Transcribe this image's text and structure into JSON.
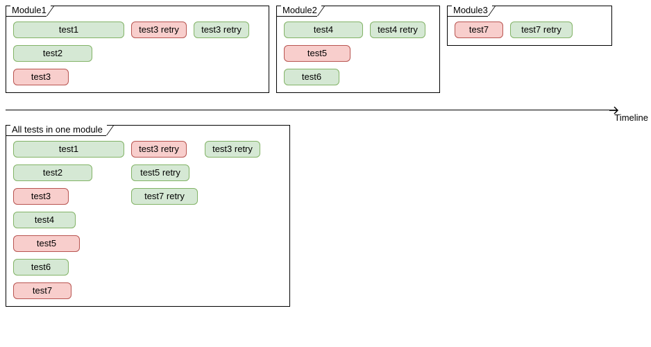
{
  "modules": {
    "m1": {
      "title": "Module1",
      "col1": [
        "test1",
        "test2",
        "test3"
      ],
      "col2": [
        "test3 retry"
      ],
      "col3": [
        "test3 retry"
      ]
    },
    "m2": {
      "title": "Module2",
      "col1": [
        "test4",
        "test5",
        "test6"
      ],
      "col2": [
        "test4 retry"
      ]
    },
    "m3": {
      "title": "Module3",
      "col1": [
        "test7"
      ],
      "col2": [
        "test7 retry"
      ]
    }
  },
  "combined": {
    "title": "All tests in one module",
    "col1": [
      "test1",
      "test2",
      "test3",
      "test4",
      "test5",
      "test6",
      "test7"
    ],
    "col2": [
      "test3 retry",
      "test5 retry",
      "test7 retry"
    ],
    "col3": [
      "test3 retry"
    ]
  },
  "timeline_label": "Timeline",
  "colors": {
    "pass_fill": "#d5e8d4",
    "pass_border": "#82b366",
    "fail_fill": "#f8cecc",
    "fail_border": "#b85450"
  }
}
